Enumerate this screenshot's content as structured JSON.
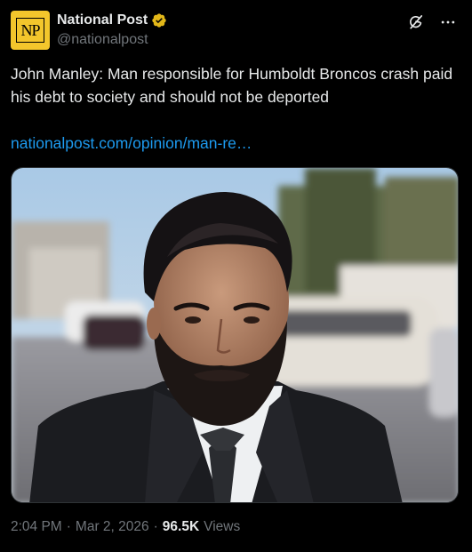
{
  "account": {
    "display_name": "National Post",
    "handle": "@nationalpost",
    "avatar_text": "NP",
    "verified": true
  },
  "icons": {
    "verified": "verified-badge-icon",
    "grok": "grok-icon",
    "more": "more-options-icon"
  },
  "tweet": {
    "text": "John Manley: Man responsible for Humboldt Broncos crash paid his debt to society and should not be deported",
    "link_text": "nationalpost.com/opinion/man-re…",
    "media_alt": "Photo of a bearded man in a dark suit, white shirt and dark tie standing in a parking lot"
  },
  "meta": {
    "time": "2:04 PM",
    "separator": "·",
    "date": "Mar 2, 2026",
    "views_count": "96.5K",
    "views_label": "Views"
  },
  "colors": {
    "background": "#000000",
    "text": "#e7e9ea",
    "muted": "#71767b",
    "link": "#1d9bf0",
    "verified_gold": "#e2b719",
    "avatar_yellow": "#f3c62c"
  }
}
